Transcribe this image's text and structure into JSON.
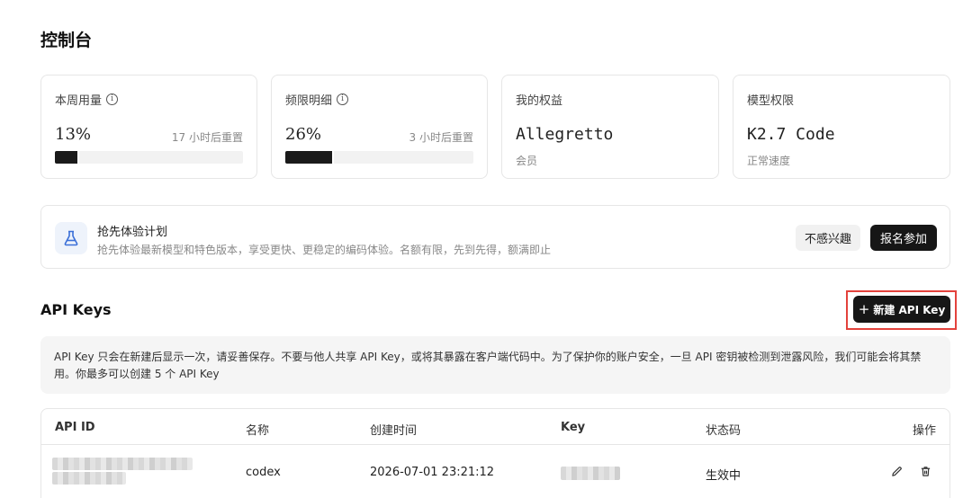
{
  "page": {
    "title": "控制台"
  },
  "cards": [
    {
      "label": "本周用量",
      "value": "13%",
      "reset": "17 小时后重置",
      "progress": 0.13
    },
    {
      "label": "频限明细",
      "value": "26%",
      "reset": "3 小时后重置",
      "progress": 0.26
    },
    {
      "label": "我的权益",
      "value": "Allegretto",
      "sub": "会员"
    },
    {
      "label": "模型权限",
      "value": "K2.7 Code",
      "sub": "正常速度"
    }
  ],
  "promo": {
    "title": "抢先体验计划",
    "description": "抢先体验最新模型和特色版本，享受更快、更稳定的编码体验。名额有限，先到先得，额满即止",
    "decline_label": "不感兴趣",
    "join_label": "报名参加"
  },
  "api_keys": {
    "title": "API Keys",
    "new_button_label": "新建 API Key",
    "notice": "API Key 只会在新建后显示一次，请妥善保存。不要与他人共享 API Key，或将其暴露在客户端代码中。为了保护你的账户安全，一旦 API 密钥被检测到泄露风险，我们可能会将其禁用。你最多可以创建 5 个 API Key",
    "columns": {
      "id": "API ID",
      "name": "名称",
      "created": "创建时间",
      "key": "Key",
      "status": "状态码",
      "actions": "操作"
    },
    "rows": [
      {
        "name": "codex",
        "created": "2026-07-01 23:21:12",
        "status": "生效中"
      }
    ]
  },
  "colors": {
    "accent_dark": "#161616",
    "highlight_border": "#e3423c"
  }
}
